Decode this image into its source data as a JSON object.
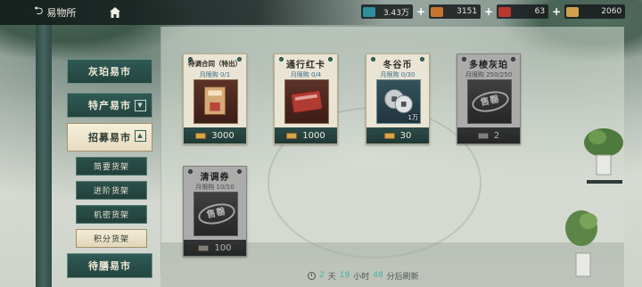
{
  "header": {
    "back_label": "易物所"
  },
  "currencies": [
    {
      "icon": "jade-ticket-icon",
      "color": "#2f8f9a",
      "value": "3.43万"
    },
    {
      "icon": "orange-crate-icon",
      "color": "#c9742e",
      "value": "3151"
    },
    {
      "icon": "red-box-icon",
      "color": "#b8392f",
      "value": "63"
    },
    {
      "icon": "gold-coupon-icon",
      "color": "#d0a04c",
      "value": "2060"
    }
  ],
  "nav": {
    "main": [
      {
        "label": "灰珀易市"
      },
      {
        "label": "特产易市"
      },
      {
        "label": "招募易市"
      },
      {
        "label": "待膳易市"
      }
    ],
    "sub": [
      {
        "label": "简要货架"
      },
      {
        "label": "进阶货架"
      },
      {
        "label": "机密货架"
      },
      {
        "label": "积分货架"
      }
    ]
  },
  "items": [
    {
      "name": "特调合同（特出）",
      "limit": "月限购 0/1",
      "price": "3000",
      "quantity": "",
      "sold_out": false,
      "icon": "contract-book-icon"
    },
    {
      "name": "通行红卡",
      "limit": "月限购 0/4",
      "price": "1000",
      "quantity": "",
      "sold_out": false,
      "icon": "red-card-icon"
    },
    {
      "name": "冬谷币",
      "limit": "月限购 0/30",
      "price": "30",
      "quantity": "1万",
      "sold_out": false,
      "icon": "silver-coins-icon"
    },
    {
      "name": "多棱灰珀",
      "limit": "月限购 250/250",
      "price": "2",
      "quantity": "",
      "sold_out": true,
      "stamp": "售罄",
      "icon": "grey-gem-icon"
    },
    {
      "name": "清调券",
      "limit": "月限购 10/10",
      "price": "100",
      "quantity": "",
      "sold_out": true,
      "stamp": "售罄",
      "icon": "ticket-icon"
    }
  ],
  "refresh": {
    "days": "2",
    "day_unit": "天",
    "hours": "19",
    "hour_unit": "小时",
    "minutes": "48",
    "minute_unit": "分后刷新"
  }
}
